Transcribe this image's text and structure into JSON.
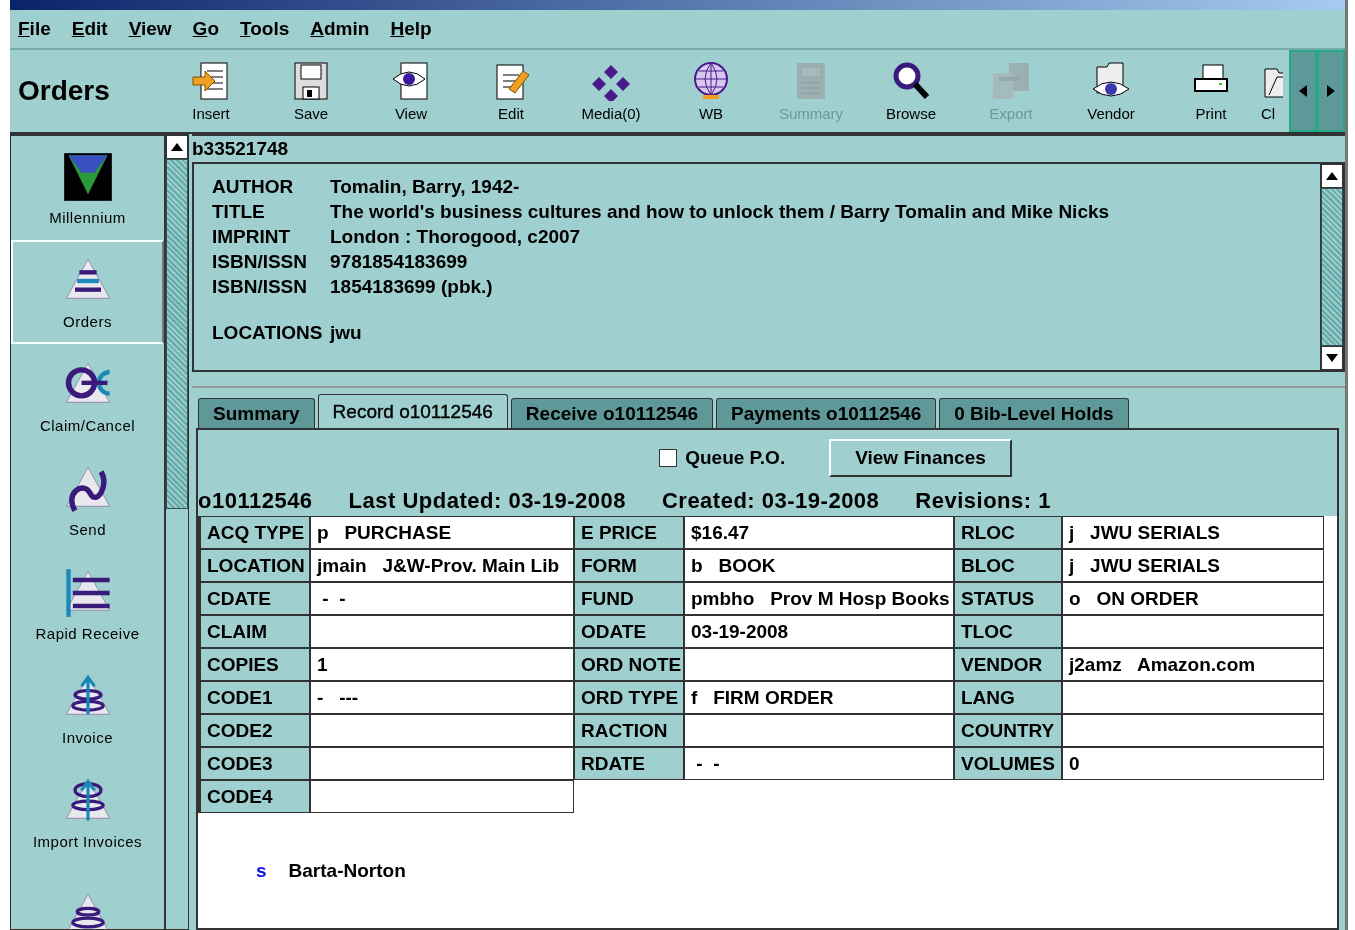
{
  "menu": [
    "File",
    "Edit",
    "View",
    "Go",
    "Tools",
    "Admin",
    "Help"
  ],
  "toolbar": {
    "title": "Orders",
    "items": [
      {
        "label": "Insert",
        "disabled": false
      },
      {
        "label": "Save",
        "disabled": false
      },
      {
        "label": "View",
        "disabled": false
      },
      {
        "label": "Edit",
        "disabled": false
      },
      {
        "label": "Media(0)",
        "disabled": false
      },
      {
        "label": "WB",
        "disabled": false
      },
      {
        "label": "Summary",
        "disabled": true
      },
      {
        "label": "Browse",
        "disabled": false
      },
      {
        "label": "Export",
        "disabled": true
      },
      {
        "label": "Vendor",
        "disabled": false
      },
      {
        "label": "Print",
        "disabled": false
      },
      {
        "label": "Cl",
        "disabled": false
      }
    ]
  },
  "sidebar": {
    "items": [
      {
        "label": "Millennium",
        "selected": false
      },
      {
        "label": "Orders",
        "selected": true
      },
      {
        "label": "Claim/Cancel",
        "selected": false
      },
      {
        "label": "Send",
        "selected": false
      },
      {
        "label": "Rapid Receive",
        "selected": false
      },
      {
        "label": "Invoice",
        "selected": false
      },
      {
        "label": "Import Invoices",
        "selected": false
      },
      {
        "selected": false
      }
    ]
  },
  "bib": {
    "record": "b33521748",
    "fields": [
      {
        "label": "AUTHOR",
        "value": "Tomalin, Barry, 1942-"
      },
      {
        "label": "TITLE",
        "value": "The world's business cultures and how to unlock them / Barry Tomalin and Mike Nicks"
      },
      {
        "label": "IMPRINT",
        "value": "London : Thorogood, c2007"
      },
      {
        "label": "ISBN/ISSN",
        "value": "9781854183699"
      },
      {
        "label": "ISBN/ISSN",
        "value": "1854183699 (pbk.)"
      }
    ],
    "locations": {
      "label": "LOCATIONS",
      "value": "jwu"
    }
  },
  "tabs": [
    {
      "label": "Summary",
      "selected": false
    },
    {
      "label": "Record o10112546",
      "selected": true
    },
    {
      "label": "Receive o10112546",
      "selected": false
    },
    {
      "label": "Payments o10112546",
      "selected": false
    },
    {
      "label": "0 Bib-Level Holds",
      "selected": false
    }
  ],
  "queue_po": {
    "label": "Queue P.O.",
    "checked": false
  },
  "view_finances": "View Finances",
  "order_header": {
    "record": "o10112546",
    "last_updated": "Last Updated: 03-19-2008",
    "created": "Created: 03-19-2008",
    "revisions": "Revisions: 1"
  },
  "fields": [
    [
      {
        "label": "ACQ TYPE",
        "value": "p   PURCHASE"
      },
      {
        "label": "E PRICE",
        "value": "$16.47"
      },
      {
        "label": "RLOC",
        "value": "j   JWU SERIALS"
      }
    ],
    [
      {
        "label": "LOCATION",
        "value": "jmain   J&W-Prov. Main Lib"
      },
      {
        "label": "FORM",
        "value": "b   BOOK"
      },
      {
        "label": "BLOC",
        "value": "j   JWU SERIALS"
      }
    ],
    [
      {
        "label": "CDATE",
        "value": " -  -"
      },
      {
        "label": "FUND",
        "value": "pmbho   Prov M Hosp Books"
      },
      {
        "label": "STATUS",
        "value": "o   ON ORDER"
      }
    ],
    [
      {
        "label": "CLAIM"
      },
      {
        "label": "ODATE",
        "value": "03-19-2008"
      },
      {
        "label": "TLOC"
      }
    ],
    [
      {
        "label": "COPIES",
        "value": "1"
      },
      {
        "label": "ORD NOTE"
      },
      {
        "label": "VENDOR",
        "value": "j2amz   Amazon.com"
      }
    ],
    [
      {
        "label": "CODE1",
        "value": "-   ---"
      },
      {
        "label": "ORD TYPE",
        "value": "f   FIRM ORDER"
      },
      {
        "label": "LANG"
      }
    ],
    [
      {
        "label": "CODE2"
      },
      {
        "label": "RACTION"
      },
      {
        "label": "COUNTRY"
      }
    ],
    [
      {
        "label": "CODE3"
      },
      {
        "label": "RDATE",
        "value": " -  -"
      },
      {
        "label": "VOLUMES",
        "value": "0"
      }
    ],
    [
      {
        "label": "CODE4"
      }
    ]
  ],
  "note": {
    "code": "s",
    "text": "Barta-Norton"
  }
}
